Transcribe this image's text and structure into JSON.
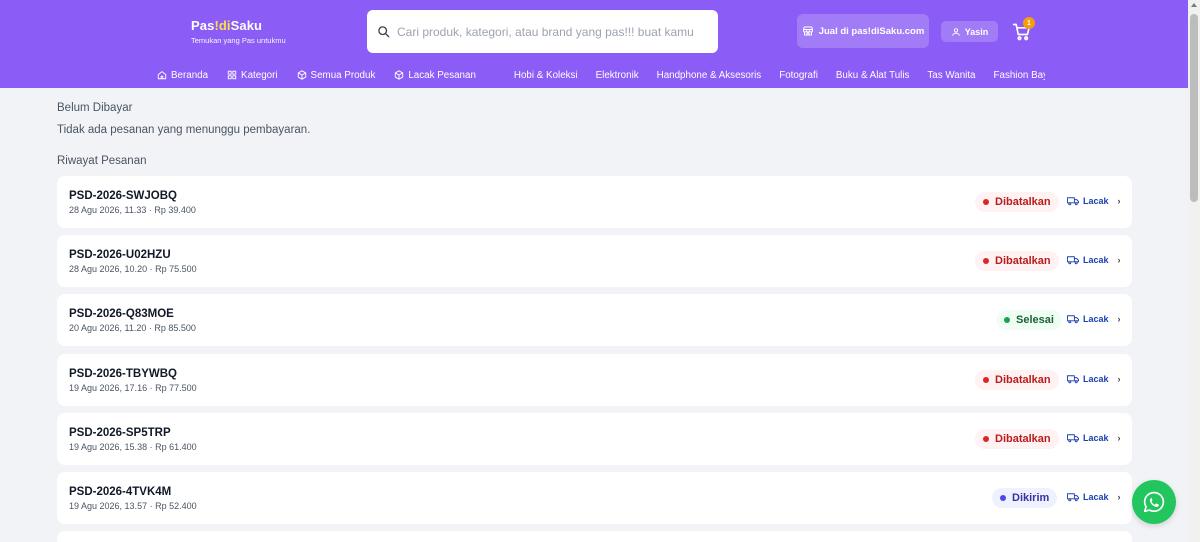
{
  "header": {
    "logo_part1": "Pas",
    "logo_part2": "!di",
    "logo_part3": "Saku",
    "tagline": "Temukan yang Pas untukmu",
    "search_placeholder": "Cari produk, kategori, atau brand yang pas!!! buat kamu",
    "sell_label": "Jual di pas!diSaku.com",
    "user_label": "Yasin",
    "cart_count": "1",
    "colors": {
      "primary": "#8b5cf6",
      "badge": "#f59e0b"
    }
  },
  "nav": {
    "main": [
      "Beranda",
      "Kategori",
      "Semua Produk",
      "Lacak Pesanan"
    ],
    "categories": [
      "Hobi & Koleksi",
      "Elektronik",
      "Handphone & Aksesoris",
      "Fotografi",
      "Buku & Alat Tulis",
      "Tas Wanita",
      "Fashion Bayi & Ana"
    ]
  },
  "unpaid": {
    "title": "Belum Dibayar",
    "empty_message": "Tidak ada pesanan yang menunggu pembayaran."
  },
  "history": {
    "title": "Riwayat Pesanan",
    "track_label": "Lacak",
    "orders": [
      {
        "id": "PSD-2026-SWJOBQ",
        "meta": "28 Agu 2026, 11.33 · Rp 39.400",
        "status": "Dibatalkan"
      },
      {
        "id": "PSD-2026-U02HZU",
        "meta": "28 Agu 2026, 10.20 · Rp 75.500",
        "status": "Dibatalkan"
      },
      {
        "id": "PSD-2026-Q83MOE",
        "meta": "20 Agu 2026, 11.20 · Rp 85.500",
        "status": "Selesai"
      },
      {
        "id": "PSD-2026-TBYWBQ",
        "meta": "19 Agu 2026, 17.16 · Rp 77.500",
        "status": "Dibatalkan"
      },
      {
        "id": "PSD-2026-SP5TRP",
        "meta": "19 Agu 2026, 15.38 · Rp 61.400",
        "status": "Dibatalkan"
      },
      {
        "id": "PSD-2026-4TVK4M",
        "meta": "19 Agu 2026, 13.57 · Rp 52.400",
        "status": "Dikirim"
      }
    ]
  }
}
